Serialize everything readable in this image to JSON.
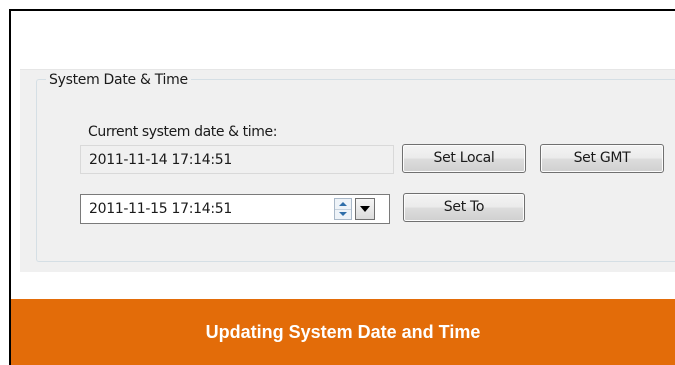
{
  "group": {
    "title": "System Date & Time"
  },
  "current": {
    "label": "Current system date & time:",
    "value": "2011-11-14 17:14:51"
  },
  "picker": {
    "value": "2011-11-15 17:14:51",
    "spin_up_icon": "arrow-up-icon",
    "spin_down_icon": "arrow-down-icon",
    "dropdown_icon": "chevron-down-icon"
  },
  "buttons": {
    "set_local": "Set Local",
    "set_gmt": "Set GMT",
    "set_to": "Set To"
  },
  "caption": "Updating System Date and Time",
  "colors": {
    "banner": "#e36c09",
    "panel": "#f0f0f0"
  }
}
